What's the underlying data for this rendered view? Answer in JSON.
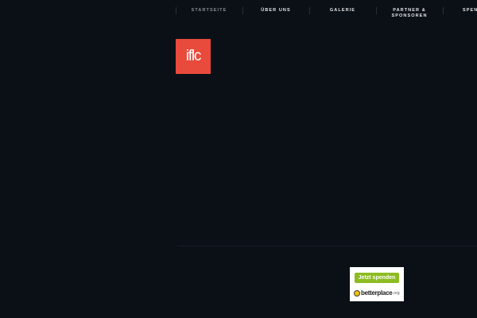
{
  "nav": {
    "items": [
      {
        "label": "STARTSEITE",
        "active": true
      },
      {
        "label": "ÜBER UNS",
        "active": false
      },
      {
        "label": "GALERIE",
        "active": false
      },
      {
        "label": "PARTNER &\nSPONSOREN",
        "active": false
      },
      {
        "label": "SPEN",
        "active": false
      }
    ]
  },
  "logo": {
    "text": "iflc",
    "color": "#e84a3c"
  },
  "donate_widget": {
    "button_label": "Jetzt spenden",
    "provider_name": "betterplace",
    "provider_tld": ".org",
    "button_color": "#8cbc22"
  },
  "colors": {
    "background": "#0b1017",
    "nav_text": "#e6e8ea",
    "nav_active_text": "#8a8f96"
  }
}
